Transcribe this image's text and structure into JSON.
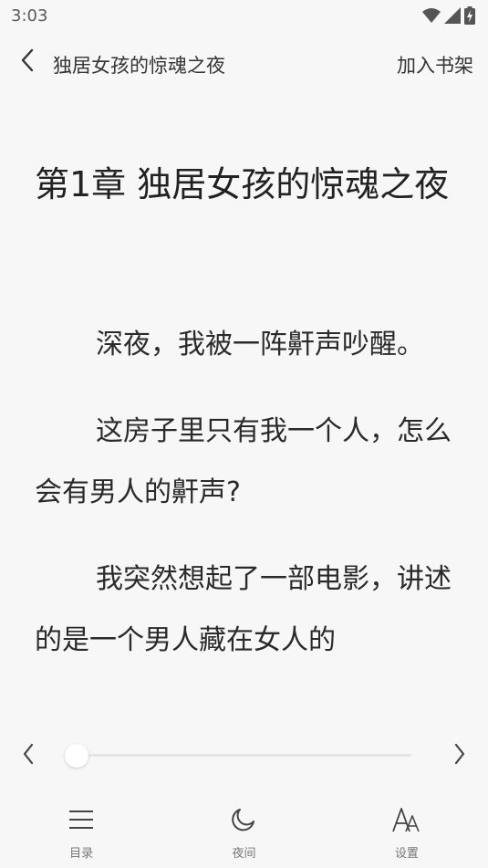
{
  "status_bar": {
    "time": "3:03",
    "icons": [
      "wifi-icon",
      "signal-icon",
      "battery-charging-icon"
    ]
  },
  "topbar": {
    "back_icon": "chevron-left-icon",
    "title": "独居女孩的惊魂之夜",
    "add_shelf": "加入书架"
  },
  "reader": {
    "chapter_title": "第1章 独居女孩的惊魂之夜",
    "paragraphs": [
      "深夜，我被一阵鼾声吵醒。",
      "这房子里只有我一个人，怎么会有男人的鼾声?",
      "我突然想起了一部电影，讲述的是一个男人藏在女人的"
    ]
  },
  "progress": {
    "prev_icon": "chevron-left-icon",
    "next_icon": "chevron-right-icon",
    "value": 0
  },
  "bottom_nav": {
    "items": [
      {
        "label": "目录",
        "icon": "menu-list-icon"
      },
      {
        "label": "夜间",
        "icon": "moon-icon"
      },
      {
        "label": "设置",
        "icon": "font-settings-icon"
      }
    ]
  },
  "colors": {
    "background": "#f7f7f7",
    "text": "#2a2a2a",
    "muted": "#777777"
  }
}
